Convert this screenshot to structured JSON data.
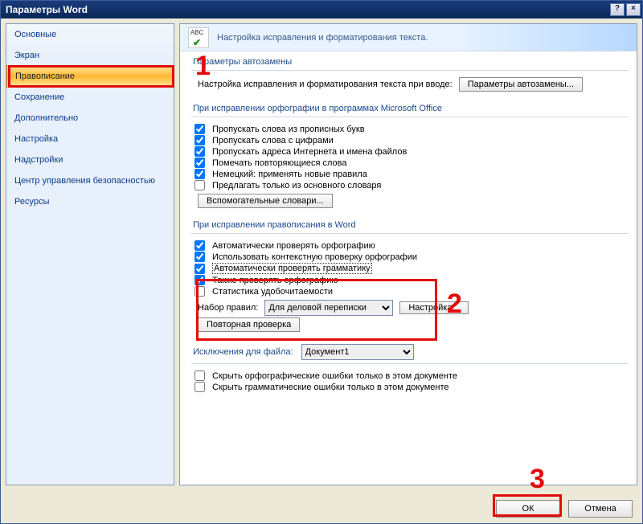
{
  "window": {
    "title": "Параметры Word"
  },
  "sidebar": {
    "items": [
      {
        "label": "Основные"
      },
      {
        "label": "Экран"
      },
      {
        "label": "Правописание"
      },
      {
        "label": "Сохранение"
      },
      {
        "label": "Дополнительно"
      },
      {
        "label": "Настройка"
      },
      {
        "label": "Надстройки"
      },
      {
        "label": "Центр управления безопасностью"
      },
      {
        "label": "Ресурсы"
      }
    ],
    "selected_index": 2
  },
  "banner": {
    "text": "Настройка исправления и форматирования текста."
  },
  "sections": {
    "autocorrect": {
      "title": "Параметры автозамены",
      "desc": "Настройка исправления и форматирования текста при вводе:",
      "button": "Параметры автозамены..."
    },
    "office_spelling": {
      "title": "При исправлении орфографии в программах Microsoft Office",
      "checks": [
        {
          "label": "Пропускать слова из прописных букв",
          "checked": true
        },
        {
          "label": "Пропускать слова с цифрами",
          "checked": true
        },
        {
          "label": "Пропускать адреса Интернета и имена файлов",
          "checked": true
        },
        {
          "label": "Помечать повторяющиеся слова",
          "checked": true
        },
        {
          "label": "Немецкий: применять новые правила",
          "checked": true
        },
        {
          "label": "Предлагать только из основного словаря",
          "checked": false
        }
      ],
      "dict_button": "Вспомогательные словари..."
    },
    "word_spelling": {
      "title": "При исправлении правописания в Word",
      "checks": [
        {
          "label": "Автоматически проверять орфографию",
          "checked": true
        },
        {
          "label": "Использовать контекстную проверку орфографии",
          "checked": true
        },
        {
          "label": "Автоматически проверять грамматику",
          "checked": true
        },
        {
          "label": "Также проверять орфографию",
          "checked": true
        },
        {
          "label": "Статистика удобочитаемости",
          "checked": false
        }
      ],
      "ruleset_label": "Набор правил:",
      "ruleset_value": "Для деловой переписки",
      "settings_button": "Настройка...",
      "recheck_button": "Повторная проверка"
    },
    "exceptions": {
      "title": "Исключения для файла:",
      "file_value": "Документ1",
      "checks": [
        {
          "label": "Скрыть орфографические ошибки только в этом документе",
          "checked": false
        },
        {
          "label": "Скрыть грамматические ошибки только в этом документе",
          "checked": false
        }
      ]
    }
  },
  "footer": {
    "ok": "ОК",
    "cancel": "Отмена"
  },
  "annotations": {
    "n1": "1",
    "n2": "2",
    "n3": "3"
  }
}
